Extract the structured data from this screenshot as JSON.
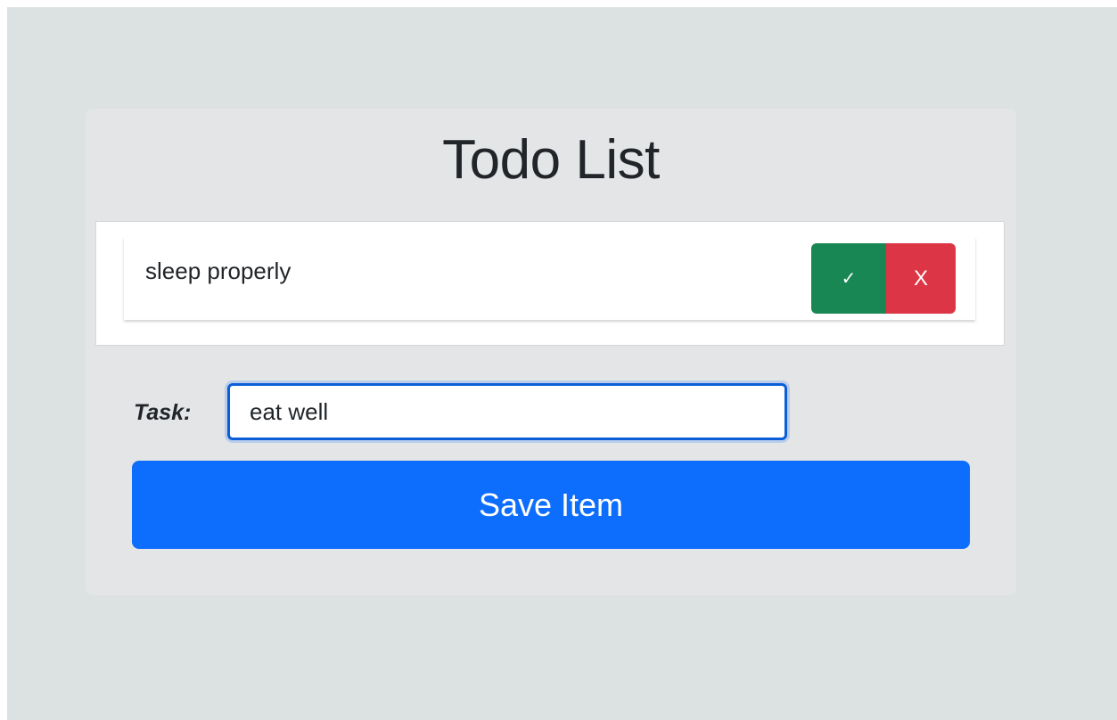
{
  "app": {
    "title": "Todo List"
  },
  "todo_items": [
    {
      "text": "sleep properly",
      "done_icon": "checkmark-icon",
      "done_glyph": "✓",
      "delete_label": "X"
    }
  ],
  "form": {
    "task_label": "Task:",
    "task_value": "eat well",
    "save_label": "Save Item"
  },
  "colors": {
    "background": "#dce1e1",
    "card": "#e4e5e6",
    "done_button": "#198754",
    "delete_button": "#dc3545",
    "primary": "#0d6efd"
  }
}
